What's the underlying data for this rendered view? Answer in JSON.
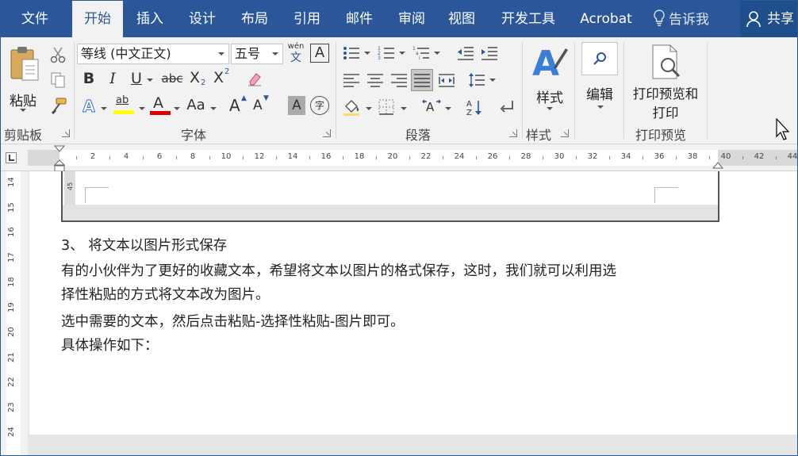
{
  "tabs": {
    "file": "文件",
    "home": "开始",
    "insert": "插入",
    "design": "设计",
    "layout": "布局",
    "references": "引用",
    "mailings": "邮件",
    "review": "审阅",
    "view": "视图",
    "developer": "开发工具",
    "acrobat": "Acrobat",
    "tell_me": "告诉我",
    "share": "共享"
  },
  "ribbon": {
    "clipboard": {
      "paste": "粘贴",
      "group": "剪贴板"
    },
    "font": {
      "font_name": "等线 (中文正文)",
      "font_size": "五号",
      "phonetic_top": "wén",
      "phonetic_bottom": "文",
      "char_border": "A",
      "bold": "B",
      "italic": "I",
      "underline": "U",
      "strikethrough": "abc",
      "subscript": "X",
      "superscript": "X",
      "text_effect": "A",
      "highlight": "ab",
      "font_color": "A",
      "change_case": "Aa",
      "grow": "A",
      "shrink": "A",
      "char_shading": "A",
      "enclose": "字",
      "group": "字体"
    },
    "paragraph": {
      "group": "段落",
      "sort": "A↓"
    },
    "styles": {
      "label": "样式",
      "group": "样式"
    },
    "editing": {
      "label": "编辑"
    },
    "print_preview": {
      "label_line1": "打印预览和",
      "label_line2": "打印",
      "group": "打印预览"
    }
  },
  "ruler": {
    "numbers": [
      "2",
      "4",
      "6",
      "8",
      "10",
      "12",
      "14",
      "16",
      "18",
      "20",
      "22",
      "24",
      "26",
      "28",
      "30",
      "32",
      "34",
      "36",
      "38",
      "40",
      "42",
      "44"
    ],
    "vertical_numbers": [
      "14",
      "15",
      "16",
      "17",
      "18",
      "19",
      "20",
      "21",
      "22",
      "23",
      "24"
    ]
  },
  "document": {
    "embedded_ruler_num": "45",
    "heading": "3、 将文本以图片形式保存",
    "para1_line1": "有的小伙伴为了更好的收藏文本，希望将文本以图片的格式保存，这时，我们就可以利用选",
    "para1_line2": "择性粘贴的方式将文本改为图片。",
    "para2": "选中需要的文本，然后点击粘贴-选择性粘贴-图片即可。",
    "para3": "具体操作如下："
  },
  "colors": {
    "accent": "#2b579a",
    "highlight": "#ffff00",
    "font_color": "#e00000"
  }
}
